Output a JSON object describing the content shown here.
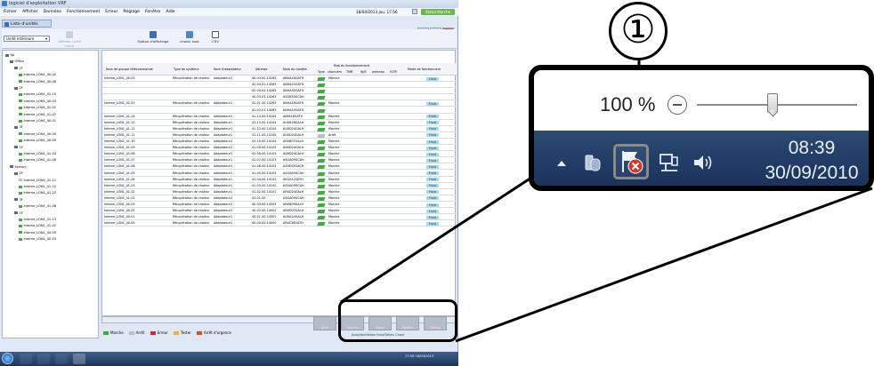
{
  "window": {
    "title": "logiciel d'exploitation VRF",
    "menus": [
      "Fichier",
      "Afficher",
      "Données",
      "Fonctionnement",
      "Erreur",
      "Réglage",
      "Fenêtre",
      "Aide"
    ],
    "datetime": "18/04/2013 jeu. 17:56",
    "mode_badge": "Statut Marche"
  },
  "document": {
    "title": "Liste d'unités"
  },
  "toolbar": {
    "unit_select": "Unité intérieure",
    "show_unit_label": "Afficher unité choisi",
    "display_option_label": "Option d'affichage",
    "choose_all_label": "choisir tout",
    "csv_label": "CSV"
  },
  "tree": {
    "nodes": [
      "fgl",
      "Office",
      "1F",
      "Interne_LON1_40-02",
      "Interne_LON1_40-06",
      "2F",
      "Interne_LON1_41-10",
      "Interne_LON1_40-03",
      "Interne_LON1_41-02",
      "Interne_LON1_41-07",
      "Interne_LON1_40-01",
      "3F",
      "Interne_LON1_40-00",
      "Interne_LON1_40-09",
      "1F",
      "Interne_LON1_41-04",
      "Interne_LON1_41-06",
      "Factory",
      "2F",
      "Interne_LON1_41-11",
      "Interne_LON1_41-12",
      "Interne_LON1_41-22",
      "3F",
      "Interne_LON1_41-08",
      "1F",
      "Interne_LON1_41-13",
      "Interne_LON1_41-01",
      "Interne_LON1_40-05",
      "Interne_LON1_40-03"
    ]
  },
  "grid": {
    "headers": {
      "group": "Nom de groupe télécommande",
      "system": "Type de système",
      "adapter": "Nom d'adaptateur",
      "address": "Adresse",
      "model": "Nom du modèle",
      "status_group": "État du fonctionnement",
      "type": "Type",
      "op": "ctionnem",
      "tmr": "TMR",
      "ws": "W/E",
      "ant": "antenan",
      "fltr": "FLTR",
      "mode": "Mode de fonctionnem"
    },
    "rows": [
      {
        "group": "Interne_LON1_40-03",
        "system": "Récupération de chaleur",
        "adapter": "Adaptateur1",
        "address": "40-03-00-14263",
        "model": "ABHA18GATH",
        "op": "Marche",
        "mode": "Froid"
      },
      {
        "group": "",
        "system": "",
        "adapter": "",
        "address": "42-04-01-14263",
        "model": "ABHA24GATH",
        "op": "",
        "mode": ""
      },
      {
        "group": "",
        "system": "",
        "adapter": "",
        "address": "42-05-02-14263",
        "model": "ABHA30GATH",
        "op": "",
        "mode": ""
      },
      {
        "group": "",
        "system": "",
        "adapter": "",
        "address": "40-03-03-14263",
        "model": "ASGB30GCAH",
        "op": "",
        "mode": ""
      },
      {
        "group": "Interne_LON1_42-01",
        "system": "Récupération de chaleur",
        "adapter": "Adaptateur1",
        "address": "42-01-00-14263",
        "model": "ABHA18GATH",
        "op": "Marche",
        "mode": "Froid"
      },
      {
        "group": "",
        "system": "",
        "adapter": "",
        "address": "42-02-01-14263",
        "model": "ABHA14GATH",
        "op": "",
        "mode": ""
      },
      {
        "group": "Interne_LON1_41-14",
        "system": "Récupération de chaleur",
        "adapter": "Adaptateur1",
        "address": "41-14-00-14104",
        "model": "ABYA18GATH",
        "op": "Marche",
        "mode": "Froid"
      },
      {
        "group": "Interne_LON1_41-13",
        "system": "Récupération de chaleur",
        "adapter": "Adaptateur1",
        "address": "41-13-00-14104",
        "model": "AUXB18GALH",
        "op": "Marche",
        "mode": "Froid"
      },
      {
        "group": "Interne_LON1_41-12",
        "system": "Récupération de chaleur",
        "adapter": "Adaptateur1",
        "address": "41-12-00-14104",
        "model": "AUXD24GALH",
        "op": "Marche",
        "mode": "Froid"
      },
      {
        "group": "Interne_LON1_41-11",
        "system": "Récupération de chaleur",
        "adapter": "Adaptateur1",
        "address": "41-11-00-14104",
        "model": "AUXD24GALH",
        "op": "Arrêt",
        "mode": "Froid"
      },
      {
        "group": "Interne_LON1_41-10",
        "system": "Récupération de chaleur",
        "adapter": "Adaptateur1",
        "address": "41-10-00-14104",
        "model": "ARXB07GALH",
        "op": "Marche",
        "mode": "Froid"
      },
      {
        "group": "Interne_LON1_41-09",
        "system": "Récupération de chaleur",
        "adapter": "Adaptateur1",
        "address": "41-09-00-14104",
        "model": "AUXD24GALH",
        "op": "Marche",
        "mode": "Froid"
      },
      {
        "group": "Interne_LON1_41-08",
        "system": "Récupération de chaleur",
        "adapter": "Adaptateur1",
        "address": "41-08-00-14103",
        "model": "AUXD24GALH",
        "op": "Marche",
        "mode": "Froid"
      },
      {
        "group": "Interne_LON1_41-07",
        "system": "Récupération de chaleur",
        "adapter": "Adaptateur1",
        "address": "41-07-00-14103",
        "model": "ASGA09GCAH",
        "op": "Marche",
        "mode": "Froid"
      },
      {
        "group": "Interne_LON1_41-06",
        "system": "Récupération de chaleur",
        "adapter": "Adaptateur1",
        "address": "41-06-00-14103",
        "model": "ASHE09GACH",
        "op": "Marche",
        "mode": "Froid"
      },
      {
        "group": "Interne_LON1_41-05",
        "system": "Récupération de chaleur",
        "adapter": "Adaptateur1",
        "address": "41-05-00-14103",
        "model": "ASGA09GCAH",
        "op": "Marche",
        "mode": "Froid"
      },
      {
        "group": "Interne_LON1_41-04",
        "system": "Récupération de chaleur",
        "adapter": "Adaptateur1",
        "address": "41-04-00-14102",
        "model": "AEGA12SATH",
        "op": "Marche",
        "mode": "Froid"
      },
      {
        "group": "Interne_LON1_41-03",
        "system": "Récupération de chaleur",
        "adapter": "Adaptateur1",
        "address": "41-03-00-14102",
        "model": "ASGA09GCAH",
        "op": "Marche",
        "mode": "Froid"
      },
      {
        "group": "Interne_LON1_41-02",
        "system": "Récupération de chaleur",
        "adapter": "Adaptateur1",
        "address": "41-02-00-14101",
        "model": "ARXD24GALH",
        "op": "Marche",
        "mode": "Froid"
      },
      {
        "group": "Interne_LON1_41-01",
        "system": "Récupération de chaleur",
        "adapter": "Adaptateur1",
        "address": "41-01-00",
        "model": "ASGA09GCAH",
        "op": "Marche",
        "mode": "Froid"
      },
      {
        "group": "Interne_LON1_40-03",
        "system": "Récupération de chaleur",
        "adapter": "Adaptateur1",
        "address": "40-03-00-14003",
        "model": "ARXB09GALH",
        "op": "Marche",
        "mode": "Froid"
      },
      {
        "group": "Interne_LON1_40-02",
        "system": "Récupération de chaleur",
        "adapter": "Adaptateur1",
        "address": "40-02-00-14002",
        "model": "ARXD07GALH",
        "op": "Marche",
        "mode": "Froid"
      },
      {
        "group": "Interne_LON1_40-01",
        "system": "Récupération de chaleur",
        "adapter": "Adaptateur1",
        "address": "40-01-00-14001",
        "model": "AUXA24GALH",
        "op": "Marche",
        "mode": "Froid"
      },
      {
        "group": "Interne_LON1_40-00",
        "system": "Récupération de chaleur",
        "adapter": "Adaptateur1",
        "address": "40-00-00-14000",
        "model": "ARXC36GATH",
        "op": "Marche",
        "mode": "Froid"
      }
    ]
  },
  "status_buttons": [
    "Arrêt",
    "Marche",
    "Temp",
    "Modèle",
    "Détails"
  ],
  "legend": [
    {
      "label": "Marche",
      "color": "#3aa83a"
    },
    {
      "label": "Arrêt",
      "color": "#bfbfbf"
    },
    {
      "label": "Erreur",
      "color": "#d02a2a"
    },
    {
      "label": "Tester",
      "color": "#e8b42a"
    },
    {
      "label": "Arrêt d'urgence",
      "color": "#d84a2a"
    }
  ],
  "subchecks": "Auto/Ventilation  Froid/Déshu  Chauf",
  "taskbar": {
    "tray_time": "17:56",
    "tray_date": "18/04/2013"
  },
  "callout": {
    "zoom_label": "100 %",
    "zoom_level_percent": 100,
    "clock_time": "08:39",
    "clock_date": "30/09/2010",
    "badge_number": "①"
  },
  "colors": {
    "accent": "#6ab84a",
    "mode_badge": "#a5dbe4",
    "error_red": "#d9342b"
  }
}
